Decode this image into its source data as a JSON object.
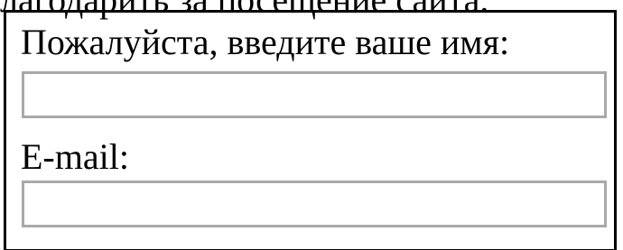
{
  "page": {
    "intro_text": "лагодарить за посещение сайта."
  },
  "form": {
    "name_label": "Пожалуйста, введите ваше имя:",
    "name_value": "",
    "email_label": "E-mail:",
    "email_value": ""
  }
}
